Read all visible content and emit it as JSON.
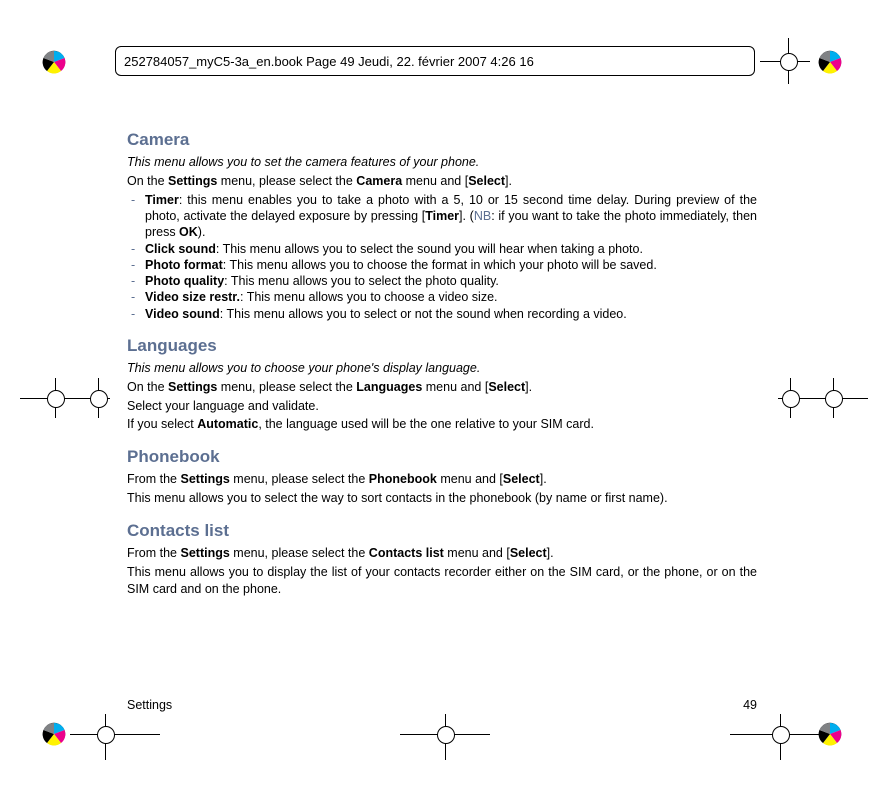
{
  "header": {
    "text": "252784057_myC5-3a_en.book  Page 49  Jeudi, 22. février 2007  4:26 16"
  },
  "sections": {
    "camera": {
      "title": "Camera",
      "intro_italic": "This menu allows you to set the camera features of your phone.",
      "line1_a": "On the ",
      "line1_b": "Settings",
      "line1_c": " menu, please select the ",
      "line1_d": "Camera",
      "line1_e": " menu and [",
      "line1_f": "Select",
      "line1_g": "].",
      "items": {
        "timer_b": "Timer",
        "timer_1": ":  this menu enables you to take a photo with a 5, 10 or 15 second time delay. During preview of the photo, activate the delayed exposure by pressing [",
        "timer_btn": "Timer",
        "timer_2": "]. (",
        "timer_nb": "NB",
        "timer_3": ": if you want to take the photo immediately, then press ",
        "timer_ok": "OK",
        "timer_4": ").",
        "click_b": "Click sound",
        "click_t": ": This menu allows you to select the sound you will hear when taking a photo.",
        "format_b": "Photo format",
        "format_t": ":  This menu allows you to choose the format in which your photo will be saved.",
        "quality_b": "Photo quality",
        "quality_t": ": This menu allows you to select the photo quality.",
        "vrestr_b": "Video size restr.",
        "vrestr_t": ": This menu allows you to choose a video size.",
        "vsound_b": "Video sound",
        "vsound_t": ": This menu allows you to select or not the sound when recording a video."
      }
    },
    "languages": {
      "title": "Languages",
      "intro_italic": "This menu allows you to choose your phone's display language.",
      "l1a": "On the ",
      "l1b": "Settings",
      "l1c": " menu, please select the ",
      "l1d": "Languages",
      "l1e": " menu and [",
      "l1f": "Select",
      "l1g": "].",
      "l2": "Select your language and validate.",
      "l3a": "If you select ",
      "l3b": "Automatic",
      "l3c": ", the language used will be the one relative to your SIM card."
    },
    "phonebook": {
      "title": "Phonebook",
      "l1a": "From the ",
      "l1b": "Settings",
      "l1c": " menu, please select the ",
      "l1d": "Phonebook",
      "l1e": " menu and [",
      "l1f": "Select",
      "l1g": "].",
      "l2": "This menu allows you to select the way to sort contacts in the phonebook (by name or first name)."
    },
    "contacts": {
      "title": "Contacts list",
      "l1a": "From the ",
      "l1b": "Settings",
      "l1c": " menu, please select the ",
      "l1d": "Contacts list",
      "l1e": " menu and [",
      "l1f": "Select",
      "l1g": "].",
      "l2": "This menu allows you to display the list of your contacts recorder either on the SIM card, or the phone, or on the SIM card and on the phone."
    }
  },
  "footer": {
    "left": "Settings",
    "right": "49"
  }
}
